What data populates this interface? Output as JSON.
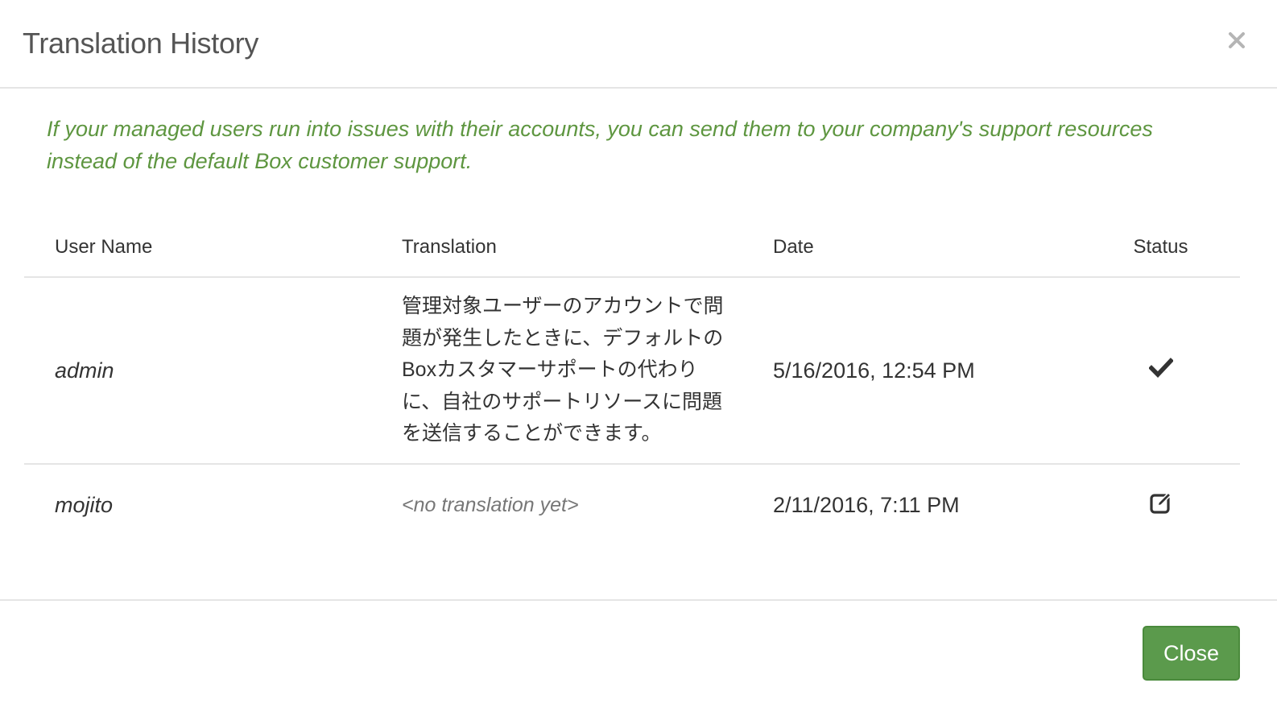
{
  "dialog": {
    "title": "Translation History",
    "close_icon": "close-x-icon",
    "help_text": "If your managed users run into issues with their accounts, you can send them to your company's support resources instead of the default Box customer support."
  },
  "table": {
    "headers": {
      "user_name": "User Name",
      "translation": "Translation",
      "date": "Date",
      "status": "Status"
    },
    "rows": [
      {
        "user": "admin",
        "translation": "管理対象ユーザーのアカウントで問題が発生したときに、デフォルトのBoxカスタマーサポートの代わりに、自社のサポートリソースに問題を送信することができます。",
        "date": "5/16/2016, 12:54 PM",
        "status_icon": "checkmark-icon"
      },
      {
        "user": "mojito",
        "translation": "<no translation yet>",
        "date": "2/11/2016, 7:11 PM",
        "status_icon": "edit-icon"
      }
    ]
  },
  "footer": {
    "close_label": "Close"
  },
  "colors": {
    "accent_green": "#5b9a4c",
    "help_text_green": "#5e9640",
    "border": "#e5e5e5"
  }
}
